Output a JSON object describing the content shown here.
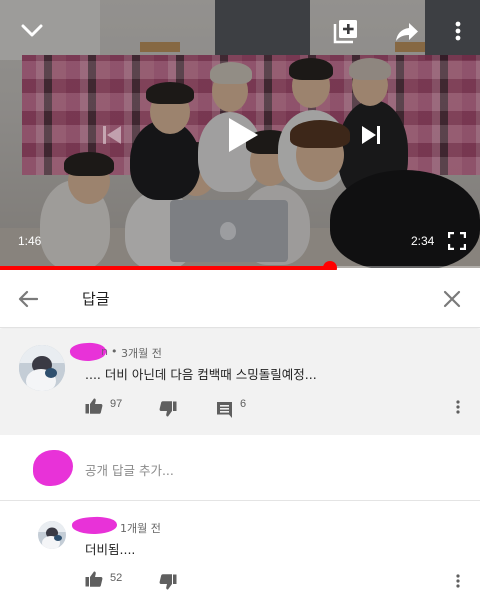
{
  "player": {
    "elapsed": "1:46",
    "duration": "2:34",
    "progress_fraction": 0.687,
    "icons": {
      "collapse": "chevron-down-icon",
      "add_to_playlist": "add-to-playlist-icon",
      "share": "share-icon",
      "more": "more-vert-icon",
      "previous": "skip-previous-icon",
      "play": "play-icon",
      "next": "skip-next-icon",
      "fullscreen": "fullscreen-icon"
    },
    "accent_color": "#ff0000"
  },
  "header": {
    "title": "답글"
  },
  "parent_comment": {
    "author": "n",
    "time": "3개월 전",
    "text": ".... 더비 아닌데 다음 컴백때 스밍돌릴예정...",
    "likes": "97",
    "replies": "6"
  },
  "add_reply": {
    "placeholder": "공개 답글 추가..."
  },
  "reply": {
    "time": "1개월 전",
    "text": "더비됨....",
    "likes": "52"
  }
}
